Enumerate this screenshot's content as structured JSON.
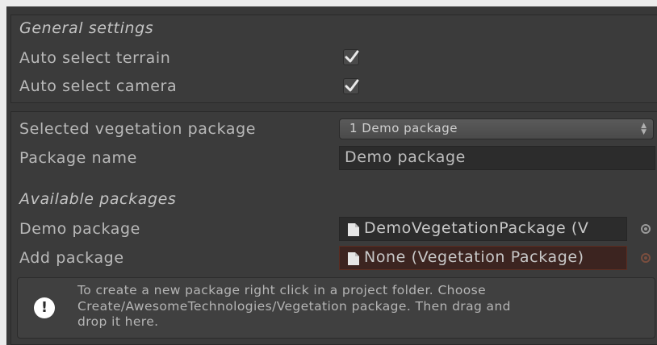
{
  "general": {
    "heading": "General settings",
    "auto_select_terrain": {
      "label": "Auto select terrain",
      "checked": true
    },
    "auto_select_camera": {
      "label": "Auto select camera",
      "checked": true
    }
  },
  "package": {
    "selected_label": "Selected vegetation package",
    "selected_value": "1 Demo package",
    "name_label": "Package name",
    "name_value": "Demo package"
  },
  "available": {
    "heading": "Available packages",
    "items": [
      {
        "label": "Demo package",
        "value": "DemoVegetationPackage (V"
      },
      {
        "label": "Add package",
        "value": "None (Vegetation Package)"
      }
    ]
  },
  "help": {
    "text_lines": [
      "To create a new package right click in a project folder. Choose",
      "Create/AwesomeTechnologies/Vegetation package. Then drag and",
      "drop it here."
    ]
  }
}
